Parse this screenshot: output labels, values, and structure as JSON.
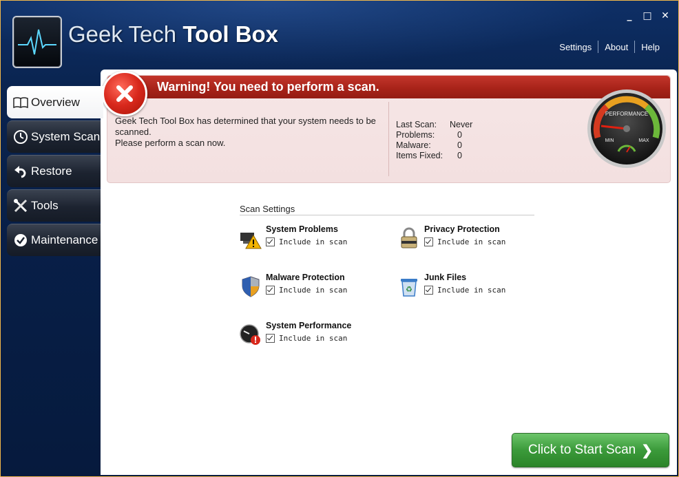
{
  "window": {
    "minimize": "_",
    "maximize": "□",
    "close": "✕"
  },
  "brand": {
    "title_light": "Geek Tech",
    "title_bold": "Tool Box"
  },
  "top_links": [
    "Settings",
    "About",
    "Help"
  ],
  "sidebar": {
    "items": [
      {
        "label": "Overview",
        "icon": "book-icon",
        "active": true
      },
      {
        "label": "System Scan",
        "icon": "clock-icon",
        "active": false
      },
      {
        "label": "Restore",
        "icon": "undo-arrow-icon",
        "active": false
      },
      {
        "label": "Tools",
        "icon": "tools-icon",
        "active": false
      },
      {
        "label": "Maintenance",
        "icon": "maintenance-icon",
        "active": false
      }
    ]
  },
  "warning": {
    "title": "Warning! You need to perform a scan.",
    "message_line1": "Geek Tech Tool Box has determined that your system needs to be scanned.",
    "message_line2": "Please perform a scan now.",
    "stats": [
      {
        "label": "Last Scan:",
        "value": "Never"
      },
      {
        "label": "Problems:",
        "value": "0"
      },
      {
        "label": "Malware:",
        "value": "0"
      },
      {
        "label": "Items Fixed:",
        "value": "0"
      }
    ],
    "gauge": {
      "label": "PERFORMANCE",
      "min_label": "MIN",
      "max_label": "MAX"
    }
  },
  "scan_settings": {
    "title": "Scan Settings",
    "options": [
      {
        "name": "System Problems",
        "check_label": "Include in scan",
        "checked": true,
        "icon": "system-problems-icon"
      },
      {
        "name": "Privacy Protection",
        "check_label": "Include in scan",
        "checked": true,
        "icon": "padlock-icon"
      },
      {
        "name": "Malware Protection",
        "check_label": "Include in scan",
        "checked": true,
        "icon": "shield-icon"
      },
      {
        "name": "Junk Files",
        "check_label": "Include in scan",
        "checked": true,
        "icon": "recycle-bin-icon"
      },
      {
        "name": "System Performance",
        "check_label": "Include in scan",
        "checked": true,
        "icon": "performance-alert-icon"
      }
    ]
  },
  "start_button": {
    "label": "Click to Start Scan",
    "chevron": "❯"
  },
  "colors": {
    "warning_red": "#a62218",
    "button_green": "#3b9a3a",
    "background_navy": "#08204a"
  }
}
